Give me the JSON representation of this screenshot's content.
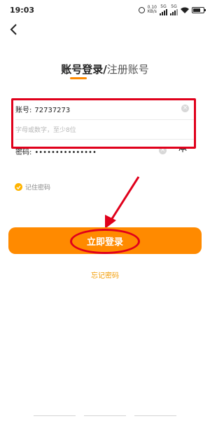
{
  "status_bar": {
    "time": "19:03",
    "net_speed": "0.10",
    "net_unit": "KB/s",
    "sig1": "5G",
    "sig2": "5G"
  },
  "header": {
    "tab_login": "账号登录",
    "separator": "/",
    "tab_register": "注册账号"
  },
  "form": {
    "account_label": "账号:",
    "account_value": "72737273",
    "hint": "字母或数字，至少8位",
    "password_label": "密码:",
    "password_value": "•••••••••••••••"
  },
  "remember_label": "记住密码",
  "login_button": "立即登录",
  "forgot_link": "忘记密码",
  "colors": {
    "accent": "#ff8a00",
    "annotation": "#e0001b",
    "link": "#f29a00"
  }
}
